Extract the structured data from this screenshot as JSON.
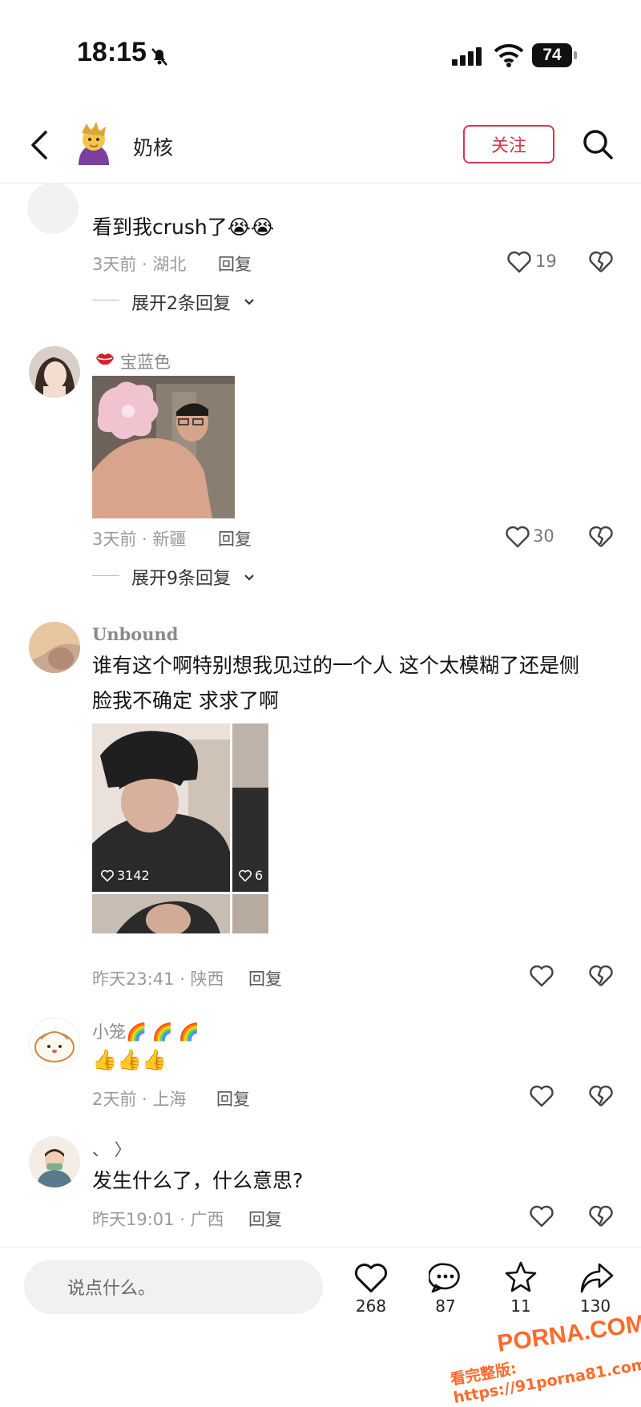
{
  "status_bar": {
    "time": "18:15",
    "battery": "74"
  },
  "header": {
    "username": "奶核",
    "follow_label": "关注"
  },
  "comments": [
    {
      "username": "",
      "text": "看到我crush了😭😭",
      "time": "3天前 · 湖北",
      "reply": "回复",
      "likes": "19",
      "expand": "展开2条回复"
    },
    {
      "username": "宝蓝色",
      "text": "",
      "time": "3天前 · 新疆",
      "reply": "回复",
      "likes": "30",
      "expand": "展开9条回复"
    },
    {
      "username": "Unbound",
      "text_line1": "谁有这个啊特别想我见过的一个人 这个太模糊了还是侧",
      "text_line2": "脸我不确定 求求了啊",
      "photo_like_1": "3142",
      "photo_like_2": "6",
      "time": "昨天23:41 · 陕西",
      "reply": "回复"
    },
    {
      "username": "小笼🌈 🌈 🌈",
      "text": "👍👍👍",
      "time": "2天前 · 上海",
      "reply": "回复"
    },
    {
      "username": "、   〉",
      "text": "发生什么了，什么意思?",
      "time": "昨天19:01 · 广西",
      "reply": "回复"
    }
  ],
  "bottom_bar": {
    "input_placeholder": "说点什么。",
    "like_count": "268",
    "comment_count": "87",
    "star_count": "11",
    "share_count": "130"
  },
  "watermark": {
    "line1": "PORNA.COM",
    "line2": "看完整版: https://91porna81.com"
  }
}
